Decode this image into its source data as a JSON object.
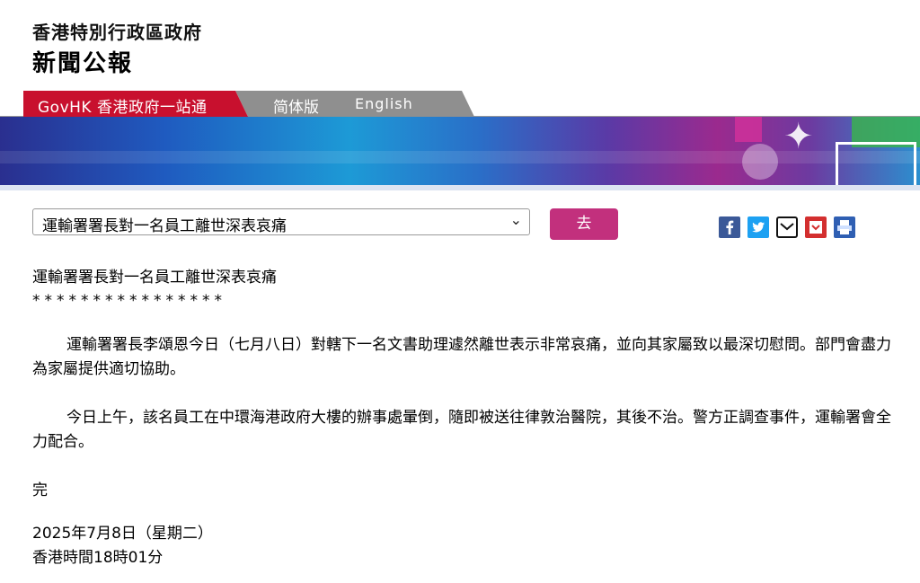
{
  "header": {
    "title": "香港特別行政區政府",
    "subtitle": "新聞公報"
  },
  "nav": {
    "govhk_label": "GovHK 香港政府一站通",
    "simplified_label": "简体版",
    "english_label": "English"
  },
  "colors": {
    "govhk_tab": "#c8102e",
    "go_button": "#c2307d",
    "facebook": "#3b5998",
    "twitter": "#1da1f2",
    "pdf": "#d32f2f",
    "print": "#2f5fb3"
  },
  "headline_select": {
    "selected": "運輸署署長對一名員工離世深表哀痛"
  },
  "go_button": {
    "label": "去"
  },
  "share_icons": [
    "facebook-icon",
    "twitter-icon",
    "email-icon",
    "pdf-icon",
    "print-icon"
  ],
  "article": {
    "title": "運輸署署長對一名員工離世深表哀痛",
    "stars": "****************",
    "paragraphs": [
      "運輸署署長李頌恩今日（七月八日）對轄下一名文書助理遽然離世表示非常哀痛，並向其家屬致以最深切慰問。部門會盡力為家屬提供適切協助。",
      "今日上午，該名員工在中環海港政府大樓的辦事處暈倒，隨即被送往律敦治醫院，其後不治。警方正調查事件，運輸署會全力配合。"
    ],
    "end": "完",
    "date": "2025年7月8日（星期二）",
    "time": "香港時間18時01分"
  }
}
